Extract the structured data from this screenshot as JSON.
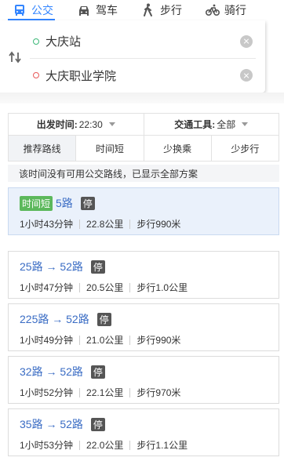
{
  "modes": [
    {
      "label": "公交",
      "icon": "bus-icon",
      "active": true
    },
    {
      "label": "驾车",
      "icon": "car-icon",
      "active": false
    },
    {
      "label": "步行",
      "icon": "walk-icon",
      "active": false
    },
    {
      "label": "骑行",
      "icon": "bike-icon",
      "active": false
    }
  ],
  "search": {
    "from": "大庆站",
    "to": "大庆职业学院"
  },
  "options": {
    "depart_label": "出发时间:",
    "depart_value": "22:30",
    "transport_label": "交通工具:",
    "transport_value": "全部",
    "sorts": [
      "推荐路线",
      "时间短",
      "少换乘",
      "少步行"
    ]
  },
  "notice": "该时间没有可用公交路线，已显示全部方案",
  "routes": [
    {
      "tag": "时间短",
      "name": "5路",
      "badge": "停",
      "duration": "1小时43分钟",
      "distance": "22.8公里",
      "walk": "步行990米"
    },
    {
      "tag": "",
      "name": "25路 → 52路",
      "badge": "停",
      "duration": "1小时47分钟",
      "distance": "20.5公里",
      "walk": "步行1.0公里"
    },
    {
      "tag": "",
      "name": "225路 → 52路",
      "badge": "停",
      "duration": "1小时49分钟",
      "distance": "21.0公里",
      "walk": "步行990米"
    },
    {
      "tag": "",
      "name": "32路 → 52路",
      "badge": "停",
      "duration": "1小时52分钟",
      "distance": "22.1公里",
      "walk": "步行970米"
    },
    {
      "tag": "",
      "name": "35路 → 52路",
      "badge": "停",
      "duration": "1小时53分钟",
      "distance": "22.0公里",
      "walk": "步行1.1公里"
    }
  ],
  "colors": {
    "accent": "#3385ff",
    "route_link": "#3a6cc4",
    "tag_green": "#5cb85c"
  }
}
